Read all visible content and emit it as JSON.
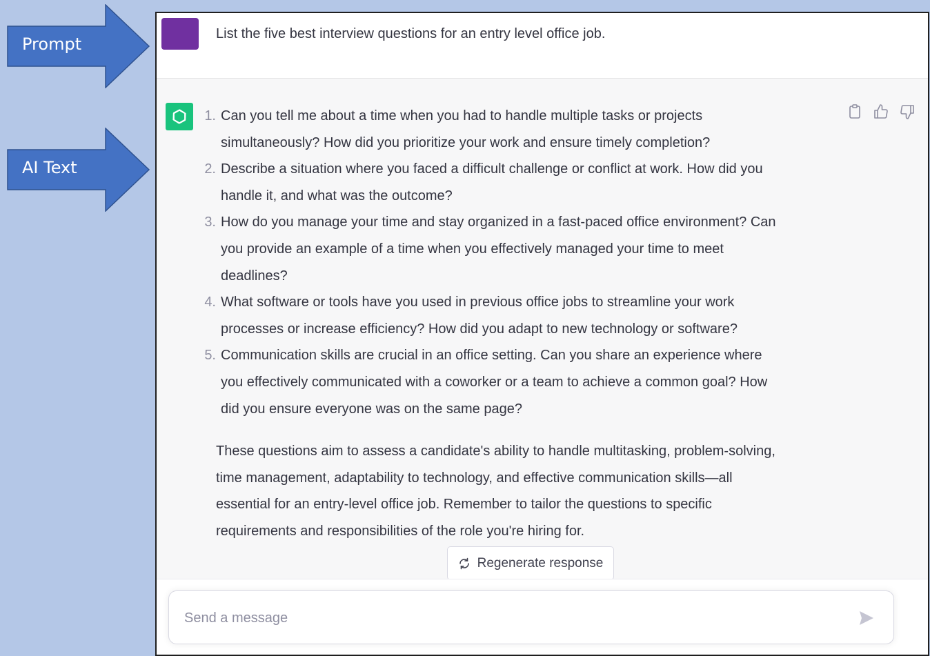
{
  "callouts": {
    "prompt_label": "Prompt",
    "ai_label": "AI Text",
    "arrow_color": "#4472c4"
  },
  "user_message": {
    "text": "List the five best interview questions for an entry level office job.",
    "avatar_color": "#7030a0"
  },
  "assistant": {
    "avatar_color": "#19c37d",
    "avatar_icon": "openai-logo-icon",
    "list": [
      {
        "num": "1.",
        "lines": [
          "Can you tell me about a time when you had to handle multiple tasks or projects",
          "simultaneously? How did you prioritize your work and ensure timely completion?"
        ]
      },
      {
        "num": "2.",
        "lines": [
          "Describe a situation where you faced a difficult challenge or conflict at work. How did you",
          "handle it, and what was the outcome?"
        ]
      },
      {
        "num": "3.",
        "lines": [
          "How do you manage your time and stay organized in a fast-paced office environment? Can",
          "you provide an example of a time when you effectively managed your time to meet",
          "deadlines?"
        ]
      },
      {
        "num": "4.",
        "lines": [
          "What software or tools have you used in previous office jobs to streamline your work",
          "processes or increase efficiency? How did you adapt to new technology or software?"
        ]
      },
      {
        "num": "5.",
        "lines": [
          "Communication skills are crucial in an office setting. Can you share an experience where",
          "you effectively communicated with a coworker or a team to achieve a common goal? How",
          "did you ensure everyone was on the same page?"
        ]
      }
    ],
    "summary_lines": [
      "These questions aim to assess a candidate's ability to handle multitasking, problem-solving,",
      "time management, adaptability to technology, and effective communication skills—all",
      "essential for an entry-level office job. Remember to tailor the questions to specific",
      "requirements and responsibilities of the role you're hiring for."
    ],
    "action_icons": [
      "clipboard-icon",
      "thumbs-up-icon",
      "thumbs-down-icon"
    ]
  },
  "regenerate": {
    "label": "Regenerate response",
    "icon": "refresh-icon"
  },
  "composer": {
    "placeholder": "Send a message",
    "value": "",
    "send_icon": "send-icon"
  }
}
